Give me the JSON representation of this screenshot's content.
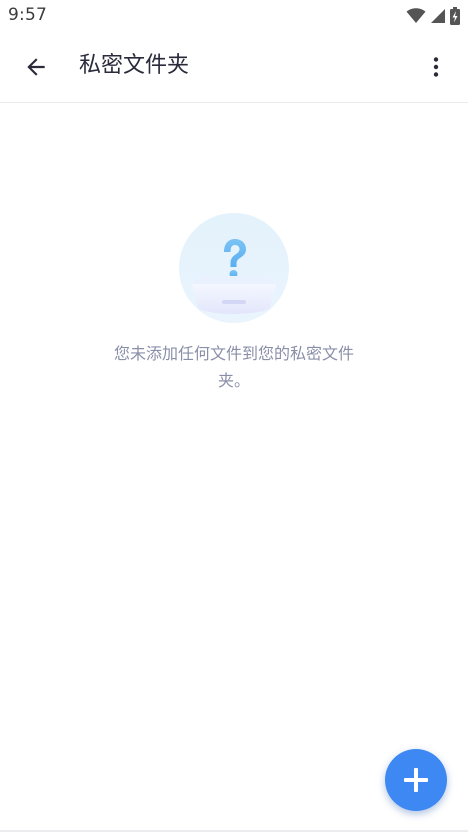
{
  "status_bar": {
    "time": "9:57",
    "icons": [
      "wifi-icon",
      "cell-signal-icon",
      "battery-icon"
    ]
  },
  "app_bar": {
    "back_icon": "arrow-left-icon",
    "title": "私密文件夹",
    "more_icon": "more-vert-icon"
  },
  "empty_state": {
    "illustration_icon": "question-box-icon",
    "message": "您未添加任何文件到您的私密文件夹。"
  },
  "fab": {
    "icon": "plus-icon"
  },
  "colors": {
    "accent": "#3d88f2",
    "title_text": "#2a2a3a",
    "secondary_text": "#8a8fa8"
  }
}
